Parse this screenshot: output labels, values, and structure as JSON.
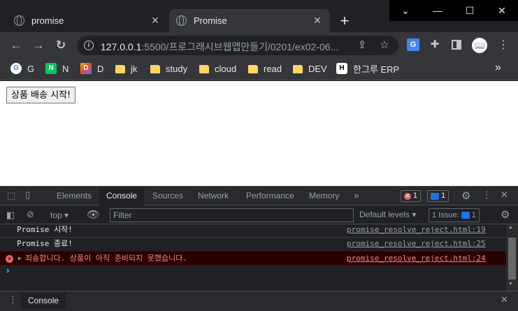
{
  "tabs": [
    {
      "title": "promise"
    },
    {
      "title": "Promise"
    }
  ],
  "window": {
    "new_tab": "+",
    "minimize": "—",
    "maximize": "☐",
    "close": "✕",
    "dropdown": "⌄"
  },
  "toolbar": {
    "url_host": "127.0.0.1",
    "url_rest": ":5500/프로그래시브웹앱만들기/0201/ex02-06...",
    "back": "←",
    "forward": "→",
    "reload": "↻"
  },
  "bookmarks": [
    {
      "label": "G",
      "icon": "google-icon"
    },
    {
      "label": "N",
      "icon": "naver-icon"
    },
    {
      "label": "D",
      "icon": "d-icon"
    },
    {
      "label": "jk",
      "icon": "folder-icon"
    },
    {
      "label": "study",
      "icon": "folder-icon"
    },
    {
      "label": "cloud",
      "icon": "folder-icon"
    },
    {
      "label": "read",
      "icon": "folder-icon"
    },
    {
      "label": "DEV",
      "icon": "folder-icon"
    },
    {
      "label": "한그루 ERP",
      "icon": "h-icon"
    }
  ],
  "page": {
    "button_label": "상품 배송 시작!"
  },
  "devtools": {
    "tabs": [
      "Elements",
      "Console",
      "Sources",
      "Network",
      "Performance",
      "Memory"
    ],
    "more_tabs": "»",
    "error_count": "1",
    "message_count": "1",
    "context": "top",
    "filter_placeholder": "Filter",
    "levels": "Default levels",
    "issues_label": "1 Issue:",
    "issues_count": "1",
    "logs": [
      {
        "message": "Promise 시작!",
        "source": "promise_resolve_reject.html:19"
      },
      {
        "message": "Promise 종료!",
        "source": "promise_resolve_reject.html:25"
      },
      {
        "message": "죄송합니다. 상품이 아직 준비되지 못했습니다.",
        "source": "promise_resolve_reject.html:24",
        "level": "error"
      }
    ],
    "prompt": "›",
    "drawer_tab": "Console"
  },
  "colors": {
    "error": "#f28b82",
    "accent": "#8ab4f8",
    "folder": "#fdd663"
  }
}
